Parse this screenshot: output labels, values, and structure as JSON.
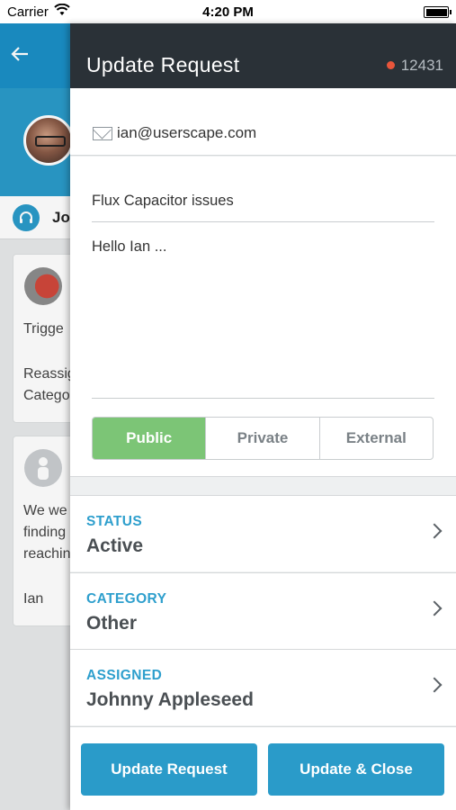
{
  "status_bar": {
    "carrier": "Carrier",
    "time": "4:20 PM"
  },
  "background_screen": {
    "contact_name": "Jo",
    "card1": {
      "line1": "Trigge",
      "line2": "Reassig",
      "line3": "Catego"
    },
    "card2": {
      "line1": "We we",
      "line2": "finding",
      "line3": "reachin",
      "line4": "Ian"
    }
  },
  "panel": {
    "title": "Update Request",
    "ticket_number": "12431",
    "email": "ian@userscape.com",
    "subject": "Flux Capacitor issues",
    "body": "Hello Ian ...",
    "visibility": {
      "options": [
        "Public",
        "Private",
        "External"
      ],
      "selected": "Public"
    },
    "fields": [
      {
        "label": "STATUS",
        "value": "Active"
      },
      {
        "label": "CATEGORY",
        "value": "Other"
      },
      {
        "label": "ASSIGNED",
        "value": "Johnny Appleseed"
      }
    ],
    "actions": {
      "update_label": "Update Request",
      "update_close_label": "Update & Close"
    }
  },
  "colors": {
    "nav_dark": "#2a3137",
    "accent_blue": "#2a9bc9",
    "public_green": "#7cc576",
    "ticket_dot": "#e8553b"
  },
  "icons": [
    "wifi-icon",
    "battery-icon",
    "back-arrow-icon",
    "headset-icon",
    "mail-icon",
    "chevron-right-icon"
  ]
}
